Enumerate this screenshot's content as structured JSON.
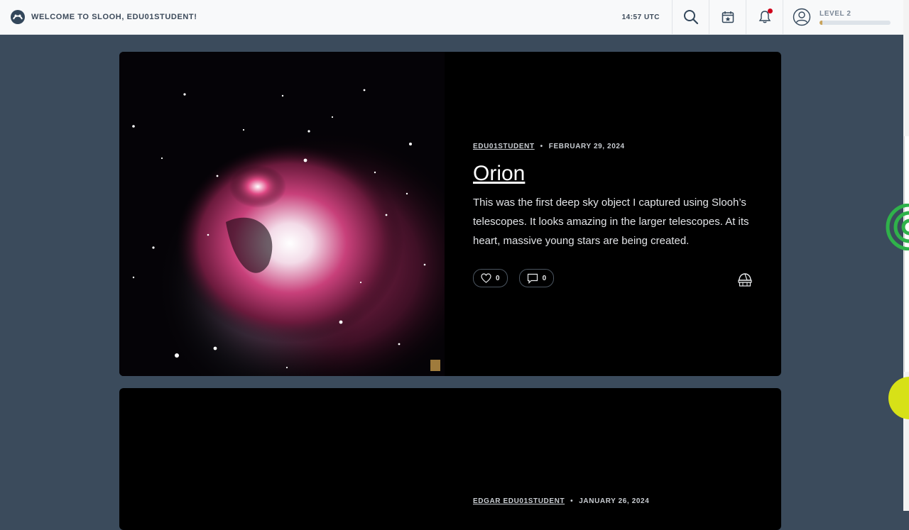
{
  "header": {
    "welcome_text": "WELCOME TO SLOOH, EDU01STUDENT!",
    "time": "14:57 UTC",
    "level_label": "LEVEL 2",
    "level_progress": 0.04
  },
  "icons": {
    "logo": "slooh-logo-icon",
    "search": "search-icon",
    "calendar": "calendar-icon",
    "notifications": "bell-icon",
    "profile": "user-avatar-icon"
  },
  "posts": [
    {
      "author": "EDU01STUDENT",
      "date": "FEBRUARY 29, 2024",
      "title": "Orion",
      "description": "This was the first deep sky object I captured using Slooh’s telescopes. It looks amazing in the larger telescopes. At its heart, massive young stars are being created.",
      "likes": "0",
      "comments": "0"
    },
    {
      "author": "EDGAR EDU01STUDENT",
      "date": "JANUARY 26, 2024"
    }
  ],
  "colors": {
    "page_bg": "#3b4b5c",
    "topbar_bg": "#f8f9fa",
    "card_bg": "#000000",
    "notification_dot": "#d0021b",
    "level_fill": "#c9a45c",
    "widget_green": "#2fb24a",
    "widget_yellow": "#d7e117"
  }
}
